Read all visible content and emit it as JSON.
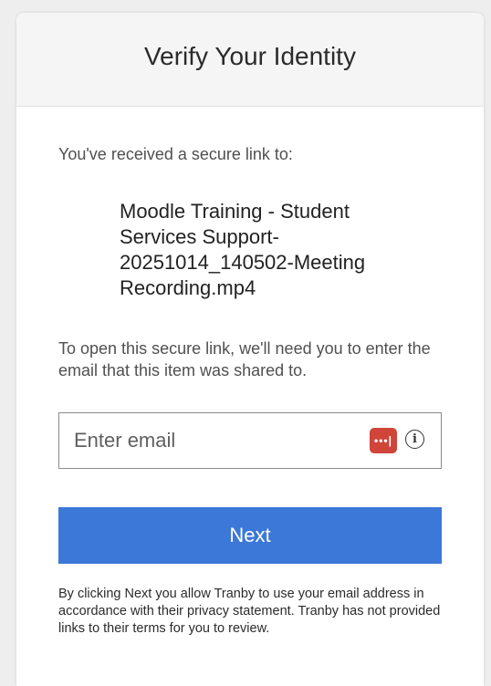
{
  "header": {
    "title": "Verify Your Identity"
  },
  "main": {
    "intro_text": "You've received a secure link to:",
    "file_name": "Moodle Training - Student Services Support-20251014_140502-Meeting Recording.mp4",
    "instructions": "To open this secure link, we'll need you to enter the email that this item was shared to.",
    "email_placeholder": "Enter email",
    "email_value": "",
    "password_manager_icon": "password-manager-icon",
    "password_manager_glyph": "•••|",
    "info_icon_glyph": "i",
    "next_label": "Next",
    "disclaimer": "By clicking Next you allow Tranby to use your email address in accordance with their privacy statement. Tranby has not provided links to their terms for you to review."
  },
  "colors": {
    "accent": "#3b78d8",
    "password_manager": "#d0453a"
  }
}
